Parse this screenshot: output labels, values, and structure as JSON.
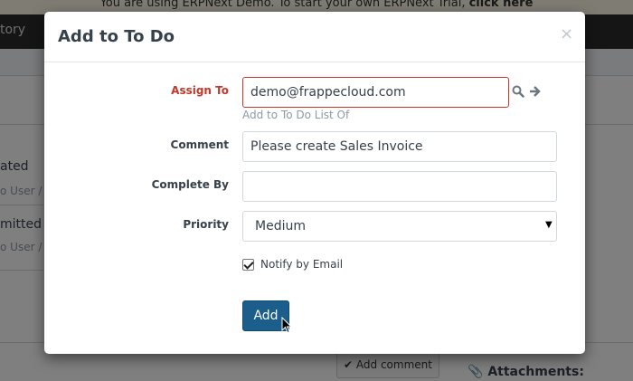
{
  "background": {
    "banner_text": "You are using ERPNext Demo. To start your own ERPNext Trial,",
    "banner_link": "click here",
    "nav_text": "tory",
    "items": [
      {
        "title": "ated",
        "meta": "o User / "
      },
      {
        "title": "mitted",
        "meta": "o User / "
      }
    ],
    "add_comment_label": "Add comment",
    "attachments_label": "Attachments:"
  },
  "modal": {
    "title": "Add to To Do",
    "close_glyph": "×",
    "fields": {
      "assign_to": {
        "label": "Assign To",
        "value": "demo@frappecloud.com",
        "help": "Add to To Do List Of"
      },
      "comment": {
        "label": "Comment",
        "value": "Please create Sales Invoice"
      },
      "complete_by": {
        "label": "Complete By",
        "value": ""
      },
      "priority": {
        "label": "Priority",
        "value": "Medium"
      },
      "notify": {
        "label": "Notify by Email",
        "checked": true
      }
    },
    "add_button": "Add"
  },
  "icons": {
    "search": "search-icon",
    "arrow": "arrow-right-icon",
    "caret": "caret-down-icon",
    "comment_check": "check-icon",
    "paperclip": "paperclip-icon",
    "cursor": "mouse-cursor-icon"
  },
  "colors": {
    "error": "#c0392b",
    "primary": "#1b5e8c",
    "navbar": "#2b2b2b"
  }
}
